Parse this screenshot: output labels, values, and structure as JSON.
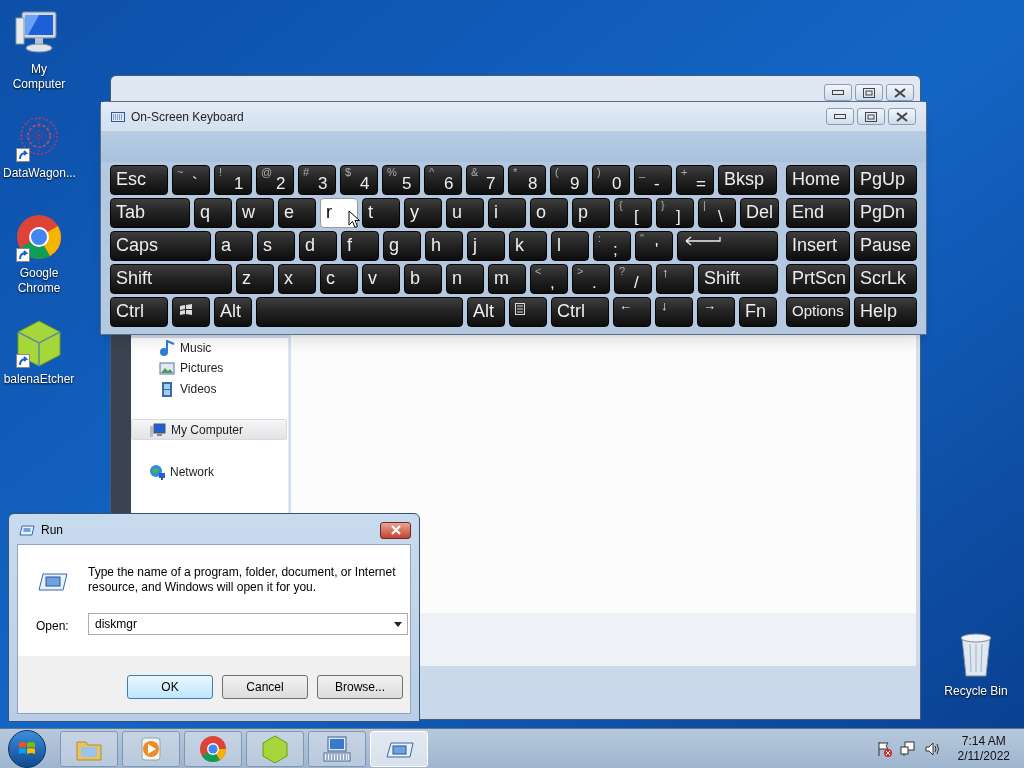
{
  "desktop_icons": [
    {
      "label": "My Computer",
      "kind": "computer",
      "shortcut": false
    },
    {
      "label": "DataWagon...",
      "kind": "pattern",
      "shortcut": true
    },
    {
      "label": "Google Chrome",
      "kind": "browser",
      "shortcut": true
    },
    {
      "label": "balenaEtcher",
      "kind": "cube",
      "shortcut": true
    }
  ],
  "recycle_bin": {
    "label": "Recycle Bin"
  },
  "explorer": {
    "nav_items": [
      {
        "label": "Music",
        "kind": "music",
        "selected": false
      },
      {
        "label": "Pictures",
        "kind": "pictures",
        "selected": false
      },
      {
        "label": "Videos",
        "kind": "videos",
        "selected": false
      },
      {
        "label": "My Computer",
        "kind": "computer",
        "selected": true
      },
      {
        "label": "Network",
        "kind": "network",
        "selected": false
      }
    ]
  },
  "keyboard": {
    "title": "On-Screen Keyboard",
    "main_rows": [
      [
        {
          "kind": "text",
          "label": "Esc",
          "highlighted": false
        },
        {
          "kind": "dual",
          "shift": "~",
          "label": "`",
          "highlighted": false
        },
        {
          "kind": "dual",
          "shift": "!",
          "label": "1",
          "highlighted": false
        },
        {
          "kind": "dual",
          "shift": "@",
          "label": "2",
          "highlighted": false
        },
        {
          "kind": "dual",
          "shift": "#",
          "label": "3",
          "highlighted": false
        },
        {
          "kind": "dual",
          "shift": "$",
          "label": "4",
          "highlighted": false
        },
        {
          "kind": "dual",
          "shift": "%",
          "label": "5",
          "highlighted": false
        },
        {
          "kind": "dual",
          "shift": "^",
          "label": "6",
          "highlighted": false
        },
        {
          "kind": "dual",
          "shift": "&",
          "label": "7",
          "highlighted": false
        },
        {
          "kind": "dual",
          "shift": "*",
          "label": "8",
          "highlighted": false
        },
        {
          "kind": "dual",
          "shift": "(",
          "label": "9",
          "highlighted": false
        },
        {
          "kind": "dual",
          "shift": ")",
          "label": "0",
          "highlighted": false
        },
        {
          "kind": "dual",
          "shift": "_",
          "label": "-",
          "highlighted": false
        },
        {
          "kind": "dual",
          "shift": "+",
          "label": "=",
          "highlighted": false
        },
        {
          "kind": "text",
          "label": "Bksp",
          "highlighted": false
        }
      ],
      [
        {
          "kind": "text",
          "label": "Tab",
          "highlighted": false
        },
        {
          "kind": "text",
          "label": "q",
          "highlighted": false
        },
        {
          "kind": "text",
          "label": "w",
          "highlighted": false
        },
        {
          "kind": "text",
          "label": "e",
          "highlighted": false
        },
        {
          "kind": "text",
          "label": "r",
          "highlighted": true
        },
        {
          "kind": "text",
          "label": "t",
          "highlighted": false
        },
        {
          "kind": "text",
          "label": "y",
          "highlighted": false
        },
        {
          "kind": "text",
          "label": "u",
          "highlighted": false
        },
        {
          "kind": "text",
          "label": "i",
          "highlighted": false
        },
        {
          "kind": "text",
          "label": "o",
          "highlighted": false
        },
        {
          "kind": "text",
          "label": "p",
          "highlighted": false
        },
        {
          "kind": "dual",
          "shift": "{",
          "label": "[",
          "highlighted": false
        },
        {
          "kind": "dual",
          "shift": "}",
          "label": "]",
          "highlighted": false
        },
        {
          "kind": "dual",
          "shift": "|",
          "label": "\\",
          "highlighted": false
        },
        {
          "kind": "text",
          "label": "Del",
          "highlighted": false
        }
      ],
      [
        {
          "kind": "text",
          "label": "Caps",
          "highlighted": false
        },
        {
          "kind": "text",
          "label": "a",
          "highlighted": false
        },
        {
          "kind": "text",
          "label": "s",
          "highlighted": false
        },
        {
          "kind": "text",
          "label": "d",
          "highlighted": false
        },
        {
          "kind": "text",
          "label": "f",
          "highlighted": false
        },
        {
          "kind": "text",
          "label": "g",
          "highlighted": false
        },
        {
          "kind": "text",
          "label": "h",
          "highlighted": false
        },
        {
          "kind": "text",
          "label": "j",
          "highlighted": false
        },
        {
          "kind": "text",
          "label": "k",
          "highlighted": false
        },
        {
          "kind": "text",
          "label": "l",
          "highlighted": false
        },
        {
          "kind": "dual",
          "shift": ":",
          "label": ";",
          "highlighted": false
        },
        {
          "kind": "dual",
          "shift": "\"",
          "label": "'",
          "highlighted": false
        },
        {
          "kind": "enter",
          "highlighted": false
        }
      ],
      [
        {
          "kind": "text",
          "label": "Shift",
          "highlighted": false
        },
        {
          "kind": "text",
          "label": "z",
          "highlighted": false
        },
        {
          "kind": "text",
          "label": "x",
          "highlighted": false
        },
        {
          "kind": "text",
          "label": "c",
          "highlighted": false
        },
        {
          "kind": "text",
          "label": "v",
          "highlighted": false
        },
        {
          "kind": "text",
          "label": "b",
          "highlighted": false
        },
        {
          "kind": "text",
          "label": "n",
          "highlighted": false
        },
        {
          "kind": "text",
          "label": "m",
          "highlighted": false
        },
        {
          "kind": "dual",
          "shift": "<",
          "label": ",",
          "highlighted": false
        },
        {
          "kind": "dual",
          "shift": ">",
          "label": ".",
          "highlighted": false
        },
        {
          "kind": "dual",
          "shift": "?",
          "label": "/",
          "highlighted": false
        },
        {
          "kind": "arrow",
          "label": "↑",
          "highlighted": false
        },
        {
          "kind": "text",
          "label": "Shift",
          "highlighted": false
        }
      ],
      [
        {
          "kind": "text",
          "label": "Ctrl",
          "highlighted": false
        },
        {
          "kind": "windows",
          "highlighted": false
        },
        {
          "kind": "text",
          "label": "Alt",
          "highlighted": false
        },
        {
          "kind": "space",
          "highlighted": false
        },
        {
          "kind": "text",
          "label": "Alt",
          "highlighted": false
        },
        {
          "kind": "menu",
          "highlighted": false
        },
        {
          "kind": "text",
          "label": "Ctrl",
          "highlighted": false
        },
        {
          "kind": "arrow",
          "label": "←",
          "highlighted": false
        },
        {
          "kind": "arrow",
          "label": "↓",
          "highlighted": false
        },
        {
          "kind": "arrow",
          "label": "→",
          "highlighted": false
        },
        {
          "kind": "text",
          "label": "Fn",
          "highlighted": false
        }
      ]
    ],
    "side_rows": [
      [
        {
          "kind": "text",
          "label": "Home",
          "highlighted": false
        },
        {
          "kind": "text",
          "label": "PgUp",
          "highlighted": false
        }
      ],
      [
        {
          "kind": "text",
          "label": "End",
          "highlighted": false
        },
        {
          "kind": "text",
          "label": "PgDn",
          "highlighted": false
        }
      ],
      [
        {
          "kind": "text",
          "label": "Insert",
          "highlighted": false
        },
        {
          "kind": "text",
          "label": "Pause",
          "highlighted": false
        }
      ],
      [
        {
          "kind": "text",
          "label": "PrtScn",
          "highlighted": false
        },
        {
          "kind": "text",
          "label": "ScrLk",
          "highlighted": false
        }
      ],
      [
        {
          "kind": "small",
          "label": "Options",
          "highlighted": false
        },
        {
          "kind": "text",
          "label": "Help",
          "highlighted": false
        }
      ]
    ]
  },
  "run": {
    "title": "Run",
    "prompt": "Type the name of a program, folder, document, or Internet resource, and Windows will open it for you.",
    "open_label": "Open:",
    "value": "diskmgr",
    "buttons": [
      {
        "label": "OK",
        "default": true
      },
      {
        "label": "Cancel",
        "default": false
      },
      {
        "label": "Browse...",
        "default": false
      }
    ]
  },
  "taskbar": {
    "items": [
      {
        "kind": "folder",
        "active": false
      },
      {
        "kind": "media",
        "active": false
      },
      {
        "kind": "browser",
        "active": false
      },
      {
        "kind": "cube",
        "active": false
      },
      {
        "kind": "keyboard",
        "active": false
      },
      {
        "kind": "run",
        "active": true
      }
    ],
    "time": "7:14 AM",
    "date": "2/11/2022"
  }
}
